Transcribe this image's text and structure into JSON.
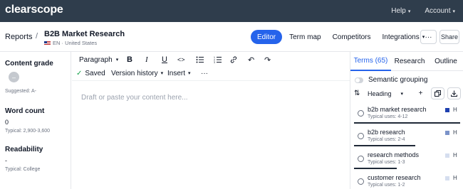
{
  "app": {
    "logo": "clearscope"
  },
  "topnav": {
    "help_label": "Help",
    "account_label": "Account"
  },
  "header": {
    "breadcrumb_root": "Reports",
    "breadcrumb_sep": "/",
    "doc_title": "B2B Market Research",
    "doc_meta": "EN · United States",
    "tabs": [
      {
        "label": "Editor",
        "active": true
      },
      {
        "label": "Term map"
      },
      {
        "label": "Competitors"
      },
      {
        "label": "Integrations"
      }
    ],
    "more_label": "···",
    "share_label": "Share"
  },
  "left": {
    "content_grade_title": "Content grade",
    "grade_value": "–",
    "grade_suggested": "Suggested: A-",
    "word_count_title": "Word count",
    "word_count_value": "0",
    "word_count_typical": "Typical: 2,900-3,600",
    "readability_title": "Readability",
    "readability_value": "-",
    "readability_typical": "Typical: College"
  },
  "editor": {
    "paragraph_label": "Paragraph",
    "saved_label": "Saved",
    "version_history_label": "Version history",
    "insert_label": "Insert",
    "more_label": "···",
    "placeholder": "Draft or paste your content here...",
    "icons": {
      "bold": "B",
      "italic": "I",
      "underline": "U",
      "code": "<>",
      "bullets": "☰",
      "numbered": "☰",
      "link": "🔗",
      "undo": "↶",
      "redo": "↷"
    }
  },
  "right": {
    "tabs": [
      {
        "label": "Terms (65)",
        "active": true
      },
      {
        "label": "Research"
      },
      {
        "label": "Outline"
      }
    ],
    "semantic_grouping_label": "Semantic grouping",
    "heading_label": "Heading",
    "terms": [
      {
        "name": "b2b market research",
        "uses": "Typical uses: 4-12",
        "h": "H",
        "color": "#1e40af",
        "bar_fill": 1.0
      },
      {
        "name": "b2b research",
        "uses": "Typical uses: 2-4",
        "h": "H",
        "color": "#7b93c9",
        "bar_fill": 0.58
      },
      {
        "name": "research methods",
        "uses": "Typical uses: 1-3",
        "h": "H",
        "color": "#d5deef",
        "bar_fill": 0.4
      },
      {
        "name": "customer research",
        "uses": "Typical uses: 1-2",
        "h": "H",
        "color": "#d5deef",
        "bar_fill": 0
      }
    ]
  },
  "colors": {
    "nav_bg": "#2f3d4c",
    "accent": "#2563eb",
    "saved_check": "#16a34a"
  }
}
